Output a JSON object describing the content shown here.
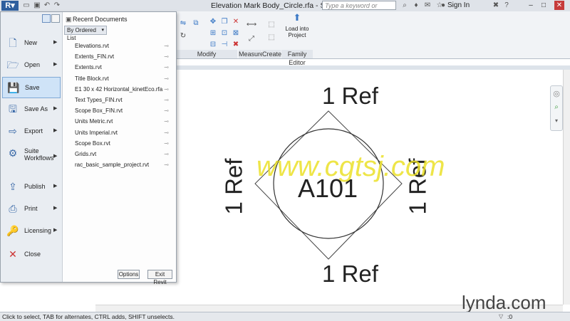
{
  "window": {
    "title": "Elevation Mark Body_Circle.rfa - She...",
    "search_placeholder": "Type a keyword or phrase",
    "sign_in": "Sign In"
  },
  "ribbon": {
    "panels": [
      "Modify",
      "Measure",
      "Create",
      "Family Editor"
    ],
    "load_into_project": "Load into Project"
  },
  "app_menu": {
    "items": [
      {
        "label": "New",
        "icon": "new-file-icon",
        "has_submenu": true
      },
      {
        "label": "Open",
        "icon": "open-folder-icon",
        "has_submenu": true
      },
      {
        "label": "Save",
        "icon": "save-icon",
        "has_submenu": false,
        "active": true
      },
      {
        "label": "Save As",
        "icon": "save-as-icon",
        "has_submenu": true
      },
      {
        "label": "Export",
        "icon": "export-icon",
        "has_submenu": true
      },
      {
        "label": "Suite Workflows",
        "icon": "workflow-icon",
        "has_submenu": true
      },
      {
        "label": "Publish",
        "icon": "publish-icon",
        "has_submenu": true
      },
      {
        "label": "Print",
        "icon": "print-icon",
        "has_submenu": true
      },
      {
        "label": "Licensing",
        "icon": "licensing-icon",
        "has_submenu": true
      },
      {
        "label": "Close",
        "icon": "close-document-icon",
        "has_submenu": false
      }
    ],
    "recent_title": "Recent Documents",
    "order_dropdown": "By Ordered List",
    "recent_documents": [
      "Elevations.rvt",
      "Extents_FIN.rvt",
      "Extents.rvt",
      "Title Block.rvt",
      "E1 30 x 42 Horizontal_kinetEco.rfa",
      "Text Types_FIN.rvt",
      "Scope Box_FIN.rvt",
      "Units Metric.rvt",
      "Units Imperial.rvt",
      "Scope Box.rvt",
      "Grids.rvt",
      "rac_basic_sample_project.rvt"
    ],
    "options_button": "Options",
    "exit_button": "Exit Revit"
  },
  "drawing": {
    "ref_top": "1 Ref",
    "ref_bottom": "1 Ref",
    "ref_left": "1 Ref",
    "ref_right": "1 Ref",
    "sheet_number": "A101"
  },
  "watermarks": {
    "site": "www.cgtsj.com",
    "brand": "lynda.com"
  },
  "status_bar": {
    "text": "Click to select, TAB for alternates, CTRL adds, SHIFT unselects.",
    "count": ":0"
  }
}
